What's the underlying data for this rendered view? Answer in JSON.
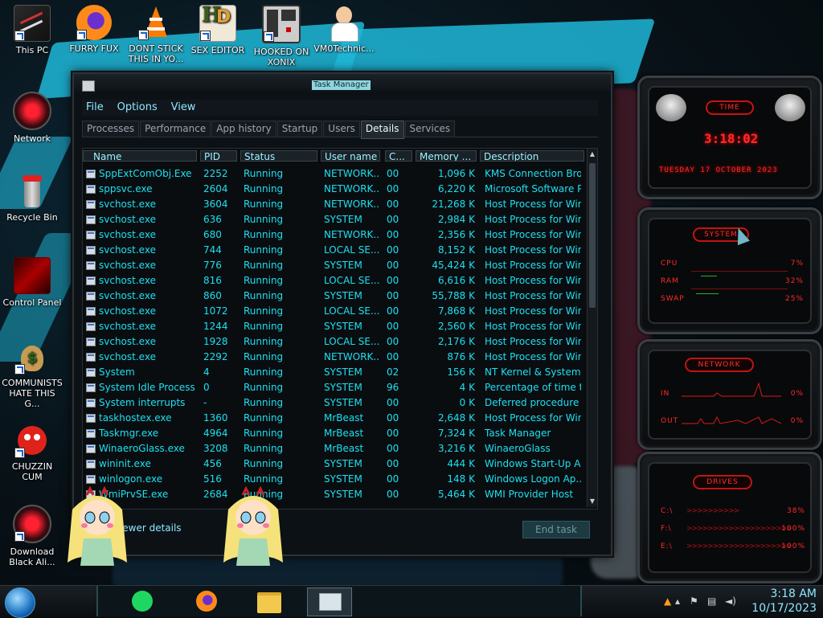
{
  "desktop_icons": [
    {
      "label": "This PC",
      "icon": "computer-icon"
    },
    {
      "label": "FURRY FUX",
      "icon": "firefox-icon"
    },
    {
      "label": "DONT STICK THIS IN YO...",
      "icon": "vlc-icon"
    },
    {
      "label": "SEX EDITOR",
      "icon": "hex-editor-icon"
    },
    {
      "label": "HOOKED ON XONIX",
      "icon": "xonix-icon"
    },
    {
      "label": "VM0Technic...",
      "icon": "doctor-icon"
    },
    {
      "label": "Network",
      "icon": "network-icon"
    },
    {
      "label": "Recycle Bin",
      "icon": "recycle-bin-icon"
    },
    {
      "label": "Control Panel",
      "icon": "control-panel-icon"
    },
    {
      "label": "COMMUNISTS HATE THIS G...",
      "icon": "money-bag-icon"
    },
    {
      "label": "CHUZZIN CUM",
      "icon": "chuzzle-icon"
    },
    {
      "label": "Download Black Ali...",
      "icon": "alienware-icon"
    }
  ],
  "window": {
    "title": "Task Manager",
    "menu": [
      "File",
      "Options",
      "View"
    ],
    "tabs": [
      "Processes",
      "Performance",
      "App history",
      "Startup",
      "Users",
      "Details",
      "Services"
    ],
    "active_tab": "Details",
    "columns": [
      "Name",
      "PID",
      "Status",
      "User name",
      "C...",
      "Memory ...",
      "Description"
    ],
    "rows": [
      [
        "SppExtComObj.Exe",
        "2252",
        "Running",
        "NETWORK...",
        "00",
        "1,096 K",
        "KMS Connection Bro..."
      ],
      [
        "sppsvc.exe",
        "2604",
        "Running",
        "NETWORK...",
        "00",
        "6,220 K",
        "Microsoft Software P..."
      ],
      [
        "svchost.exe",
        "3604",
        "Running",
        "NETWORK...",
        "00",
        "21,268 K",
        "Host Process for Win..."
      ],
      [
        "svchost.exe",
        "636",
        "Running",
        "SYSTEM",
        "00",
        "2,984 K",
        "Host Process for Win..."
      ],
      [
        "svchost.exe",
        "680",
        "Running",
        "NETWORK...",
        "00",
        "2,356 K",
        "Host Process for Win..."
      ],
      [
        "svchost.exe",
        "744",
        "Running",
        "LOCAL SE...",
        "00",
        "8,152 K",
        "Host Process for Win..."
      ],
      [
        "svchost.exe",
        "776",
        "Running",
        "SYSTEM",
        "00",
        "45,424 K",
        "Host Process for Win..."
      ],
      [
        "svchost.exe",
        "816",
        "Running",
        "LOCAL SE...",
        "00",
        "6,616 K",
        "Host Process for Win..."
      ],
      [
        "svchost.exe",
        "860",
        "Running",
        "SYSTEM",
        "00",
        "55,788 K",
        "Host Process for Win..."
      ],
      [
        "svchost.exe",
        "1072",
        "Running",
        "LOCAL SE...",
        "00",
        "7,868 K",
        "Host Process for Win..."
      ],
      [
        "svchost.exe",
        "1244",
        "Running",
        "SYSTEM",
        "00",
        "2,560 K",
        "Host Process for Win..."
      ],
      [
        "svchost.exe",
        "1928",
        "Running",
        "LOCAL SE...",
        "00",
        "2,176 K",
        "Host Process for Win..."
      ],
      [
        "svchost.exe",
        "2292",
        "Running",
        "NETWORK...",
        "00",
        "876 K",
        "Host Process for Win..."
      ],
      [
        "System",
        "4",
        "Running",
        "SYSTEM",
        "02",
        "156 K",
        "NT Kernel & System"
      ],
      [
        "System Idle Process",
        "0",
        "Running",
        "SYSTEM",
        "96",
        "4 K",
        "Percentage of time t..."
      ],
      [
        "System interrupts",
        "-",
        "Running",
        "SYSTEM",
        "00",
        "0 K",
        "Deferred procedure ..."
      ],
      [
        "taskhostex.exe",
        "1360",
        "Running",
        "MrBeast",
        "00",
        "2,648 K",
        "Host Process for Win..."
      ],
      [
        "Taskmgr.exe",
        "4964",
        "Running",
        "MrBeast",
        "00",
        "7,324 K",
        "Task Manager"
      ],
      [
        "WinaeroGlass.exe",
        "3208",
        "Running",
        "MrBeast",
        "00",
        "3,216 K",
        "WinaeroGlass"
      ],
      [
        "wininit.exe",
        "456",
        "Running",
        "SYSTEM",
        "00",
        "444 K",
        "Windows Start-Up A..."
      ],
      [
        "winlogon.exe",
        "516",
        "Running",
        "SYSTEM",
        "00",
        "148 K",
        "Windows Logon Ap..."
      ],
      [
        "WmiPrvSE.exe",
        "2684",
        "Running",
        "SYSTEM",
        "00",
        "5,464 K",
        "WMI Provider Host"
      ]
    ],
    "fewer_details": "Fewer details",
    "end_task": "End task"
  },
  "gadgets": {
    "time": {
      "label": "TIME",
      "clock": "3:18:02",
      "date": "TUESDAY 17 OCTOBER 2023"
    },
    "system": {
      "label": "SYSTEM",
      "metrics": [
        {
          "name": "CPU",
          "value": "7%"
        },
        {
          "name": "RAM",
          "value": "32%"
        },
        {
          "name": "SWAP",
          "value": "25%"
        }
      ]
    },
    "network": {
      "label": "NETWORK",
      "rows": [
        {
          "name": "IN",
          "value": "0%"
        },
        {
          "name": "OUT",
          "value": "0%"
        }
      ]
    },
    "drives": {
      "label": "DRIVES",
      "rows": [
        {
          "name": "C:\\",
          "value": "38%"
        },
        {
          "name": "F:\\",
          "value": "100%"
        },
        {
          "name": "E:\\",
          "value": "100%"
        }
      ]
    }
  },
  "taskbar": {
    "apps": [
      "spotify-icon",
      "firefox-icon",
      "file-explorer-icon",
      "task-manager-icon"
    ],
    "clock_time": "3:18 AM",
    "clock_date": "10/17/2023"
  },
  "colors": {
    "accent": "#1ce0f0",
    "gadget_red": "#ff2a2a",
    "wallpaper_blue": "#1fb7d8"
  }
}
